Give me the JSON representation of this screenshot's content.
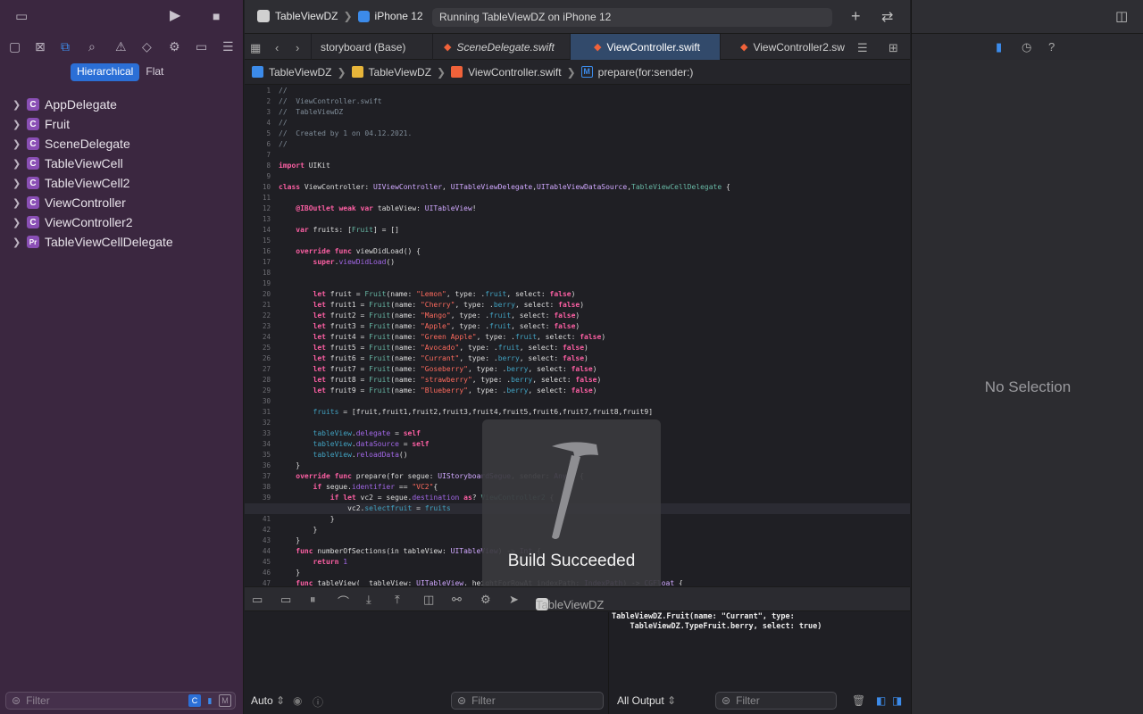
{
  "toolbar": {
    "scheme": "TableViewDZ",
    "device": "iPhone 12",
    "activity": "Running TableViewDZ on iPhone 12"
  },
  "navigator": {
    "mode_hierarchical": "Hierarchical",
    "mode_flat": "Flat",
    "items": [
      {
        "badge": "C",
        "label": "AppDelegate"
      },
      {
        "badge": "C",
        "label": "Fruit"
      },
      {
        "badge": "C",
        "label": "SceneDelegate"
      },
      {
        "badge": "C",
        "label": "TableViewCell"
      },
      {
        "badge": "C",
        "label": "TableViewCell2"
      },
      {
        "badge": "C",
        "label": "ViewController"
      },
      {
        "badge": "C",
        "label": "ViewController2"
      },
      {
        "badge": "Pr",
        "label": "TableViewCellDelegate"
      }
    ],
    "filter_placeholder": "Filter"
  },
  "tabs": [
    {
      "label": "storyboard (Base)"
    },
    {
      "label": "SceneDelegate.swift"
    },
    {
      "label": "ViewController.swift"
    },
    {
      "label": "ViewController2.sw"
    }
  ],
  "jumpbar": {
    "project": "TableViewDZ",
    "group": "TableViewDZ",
    "file": "ViewController.swift",
    "method_badge": "M",
    "method": "prepare(for:sender:)"
  },
  "code": {
    "line_numbers": [
      "1",
      "2",
      "3",
      "4",
      "5",
      "6",
      "7",
      "8",
      "9",
      "10",
      "11",
      "12",
      "13",
      "14",
      "15",
      "16",
      "17",
      "18",
      "19",
      "20",
      "21",
      "22",
      "23",
      "24",
      "25",
      "26",
      "27",
      "28",
      "29",
      "30",
      "31",
      "32",
      "33",
      "34",
      "35",
      "36",
      "37",
      "38",
      "39",
      "40",
      "41",
      "42",
      "43",
      "44",
      "45",
      "46",
      "47"
    ],
    "current_line": "40"
  },
  "hud": {
    "message": "Build Succeeded"
  },
  "debug": {
    "target": "TableViewDZ",
    "console_output": "TableViewDZ.Fruit(name: \"Currant\", type:\n    TableViewDZ.TypeFruit.berry, select: true)",
    "vars_mode": "Auto",
    "vars_filter_placeholder": "Filter",
    "output_mode": "All Output",
    "console_filter_placeholder": "Filter"
  },
  "inspector": {
    "empty_label": "No Selection"
  },
  "colors": {
    "accent": "#2b6fd6",
    "navigator_bg": "#3b2740",
    "editor_bg": "#1f1f24"
  }
}
